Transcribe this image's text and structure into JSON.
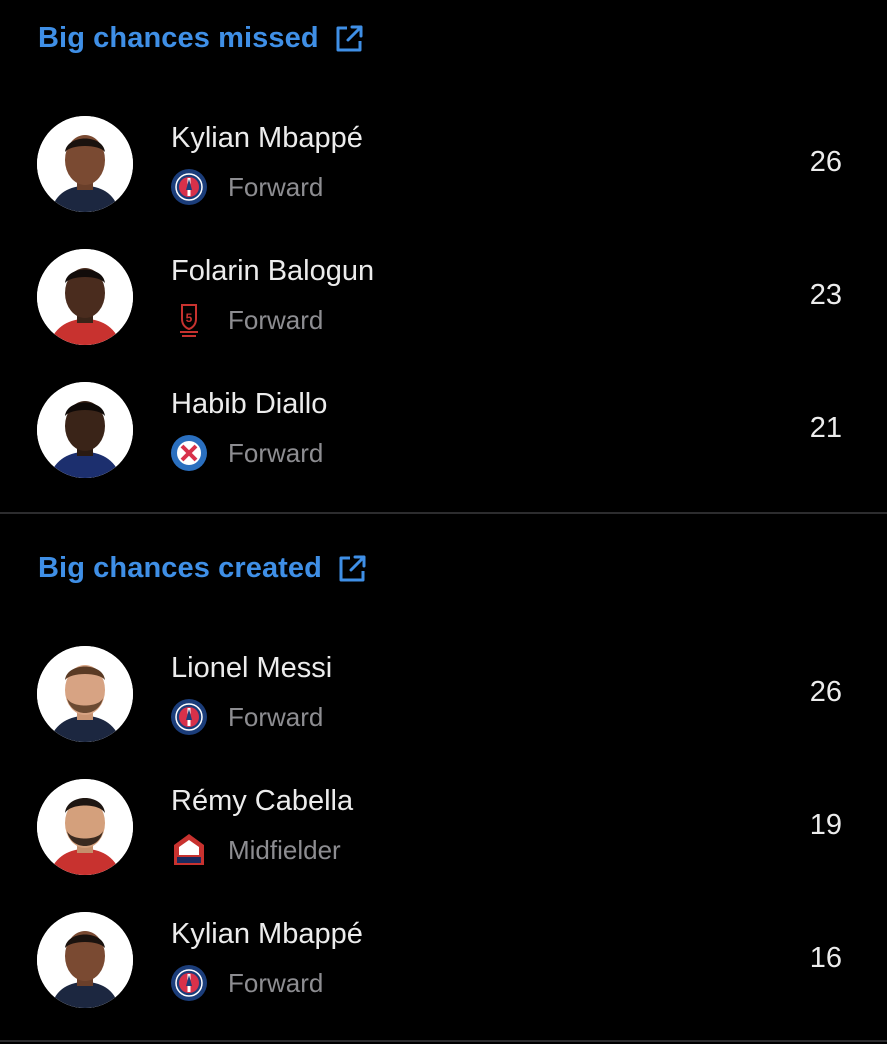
{
  "colors": {
    "background": "#000000",
    "accent": "#3f8fe6",
    "primary_text": "#ececec",
    "secondary_text": "#8d8d91",
    "divider": "#2c2c2e"
  },
  "sections": [
    {
      "title": "Big chances missed",
      "icon": "external-link-icon",
      "players": [
        {
          "name": "Kylian Mbappé",
          "position": "Forward",
          "value": "26",
          "club_badge": "psg-badge-icon",
          "avatar": "player-photo"
        },
        {
          "name": "Folarin Balogun",
          "position": "Forward",
          "value": "23",
          "club_badge": "reims-badge-icon",
          "avatar": "player-photo"
        },
        {
          "name": "Habib Diallo",
          "position": "Forward",
          "value": "21",
          "club_badge": "strasbourg-badge-icon",
          "avatar": "player-photo"
        }
      ]
    },
    {
      "title": "Big chances created",
      "icon": "external-link-icon",
      "players": [
        {
          "name": "Lionel Messi",
          "position": "Forward",
          "value": "26",
          "club_badge": "psg-badge-icon",
          "avatar": "player-photo"
        },
        {
          "name": "Rémy Cabella",
          "position": "Midfielder",
          "value": "19",
          "club_badge": "lille-badge-icon",
          "avatar": "player-photo"
        },
        {
          "name": "Kylian Mbappé",
          "position": "Forward",
          "value": "16",
          "club_badge": "psg-badge-icon",
          "avatar": "player-photo"
        }
      ]
    }
  ]
}
